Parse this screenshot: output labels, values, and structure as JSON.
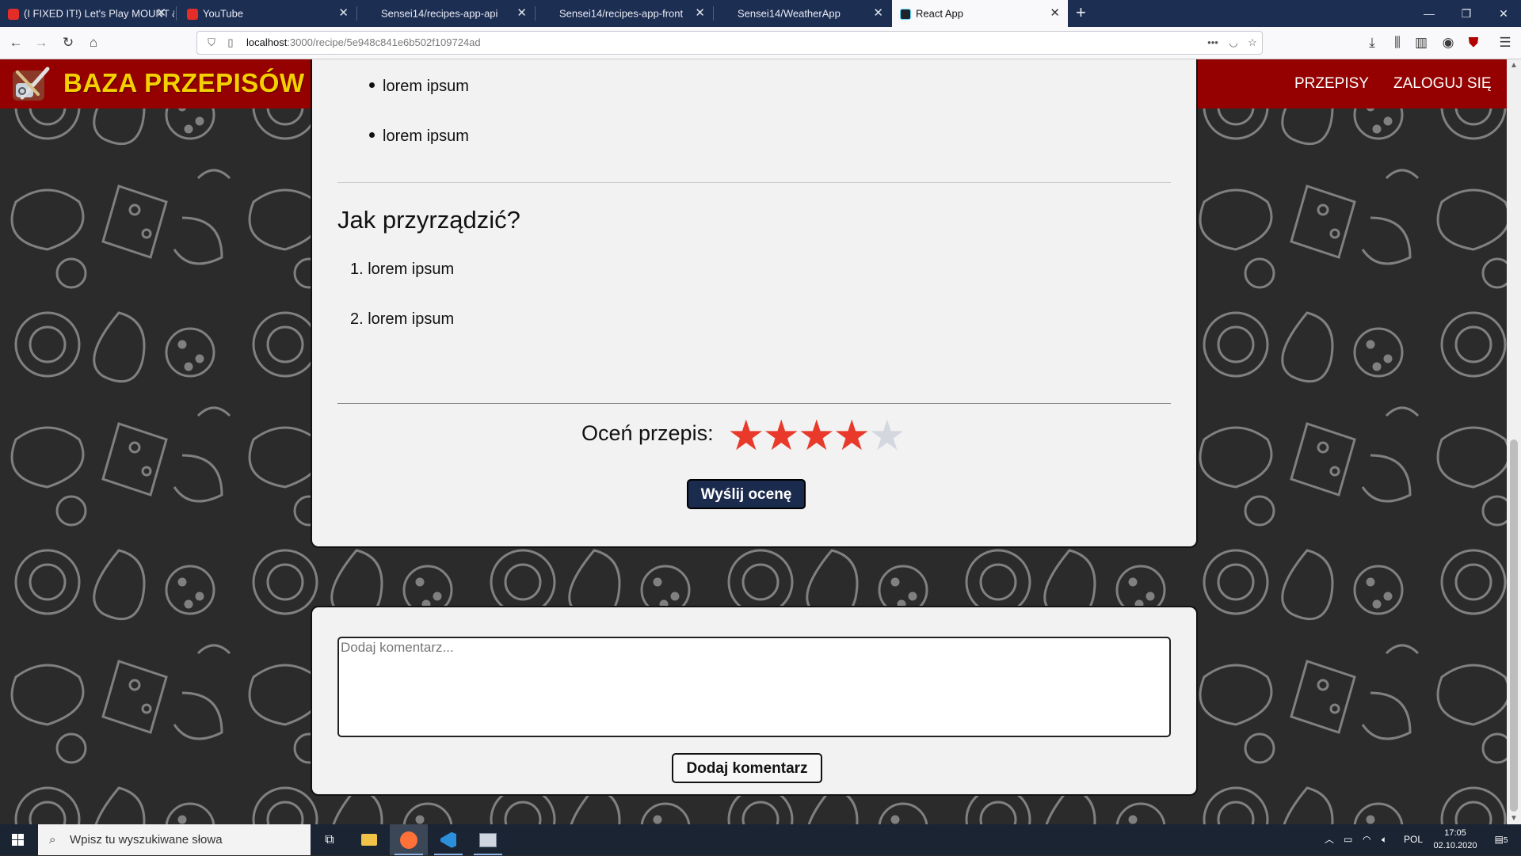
{
  "browser": {
    "tabs": [
      {
        "title": "(I FIXED IT!) Let's Play MOUNT &",
        "icon": "youtube-icon",
        "active": false
      },
      {
        "title": "YouTube",
        "icon": "youtube-icon",
        "active": false
      },
      {
        "title": "Sensei14/recipes-app-api",
        "icon": "github-icon",
        "active": false
      },
      {
        "title": "Sensei14/recipes-app-front",
        "icon": "github-icon",
        "active": false
      },
      {
        "title": "Sensei14/WeatherApp",
        "icon": "github-icon",
        "active": false
      },
      {
        "title": "React App",
        "icon": "react-icon",
        "active": true
      }
    ],
    "url_host": "localhost",
    "url_path": ":3000/recipe/5e948c841e6b502f109724ad"
  },
  "site": {
    "title": "BAZA PRZEPISÓW",
    "nav": {
      "recipes": "PRZEPISY",
      "login": "ZALOGUJ SIĘ"
    }
  },
  "recipe": {
    "ingredients_tail": [
      "lorem ipsum",
      "lorem ipsum"
    ],
    "steps_title": "Jak przyrządzić?",
    "steps": [
      "1. lorem ipsum",
      "2. lorem ipsum"
    ],
    "rating_label": "Oceń przepis:",
    "rating": {
      "value": 4,
      "max": 5
    },
    "rate_button": "Wyślij ocenę"
  },
  "comment": {
    "placeholder": "Dodaj komentarz...",
    "button": "Dodaj komentarz"
  },
  "taskbar": {
    "search_placeholder": "Wpisz tu wyszukiwane słowa",
    "language": "POL",
    "time": "17:05",
    "date": "02.10.2020",
    "notifications": "5"
  },
  "colors": {
    "header": "#950000",
    "title": "#f5d000",
    "star_on": "#e8392b",
    "star_off": "#d4d7e0",
    "rate_button": "#1b2b4d"
  }
}
